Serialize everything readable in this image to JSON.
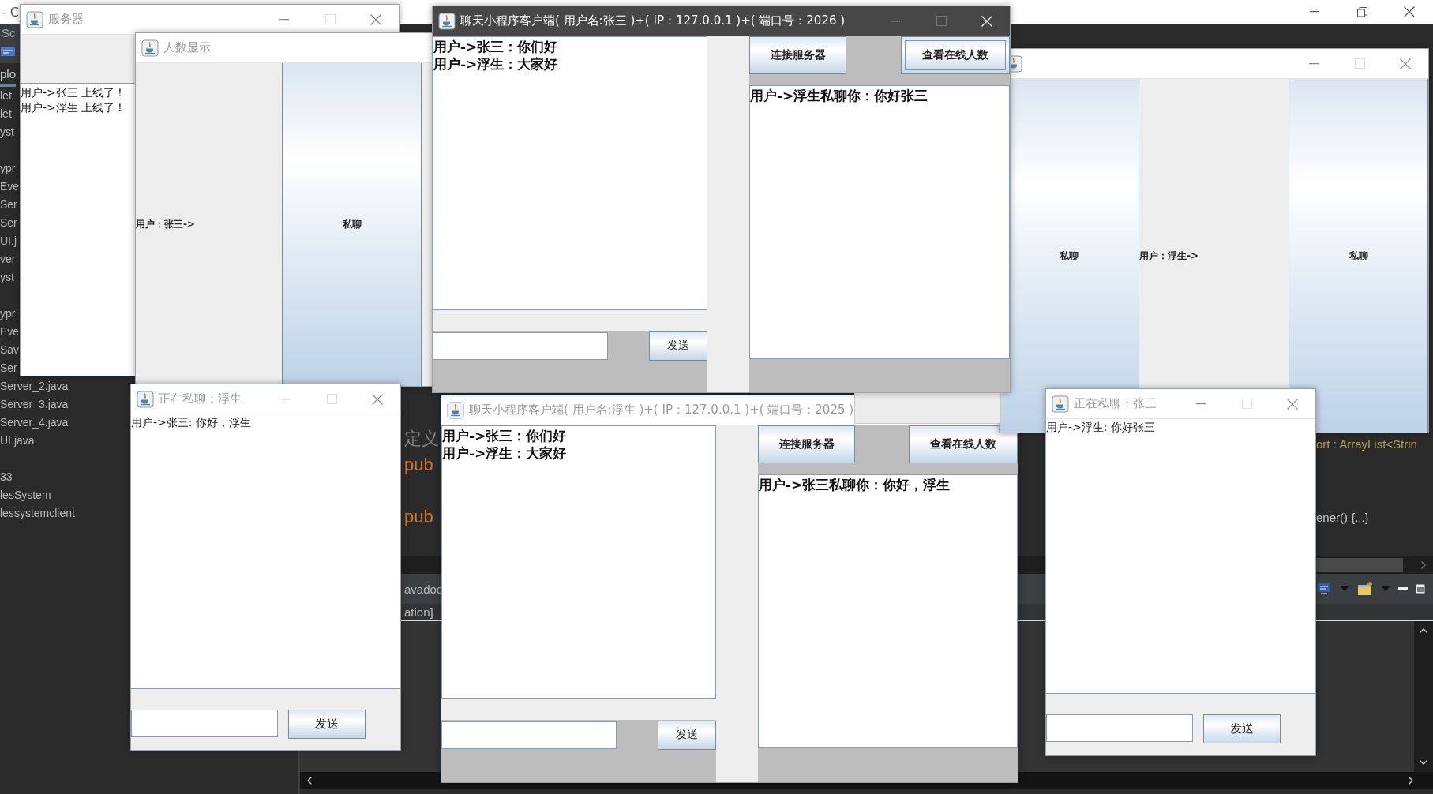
{
  "ide": {
    "title_fragment": "- C",
    "panel_tab": "Sc",
    "explorer_tab": "plo",
    "tree_groups": [
      [
        "let",
        "let",
        "yst"
      ],
      [
        "ypr",
        "Eve",
        "Ser",
        "Ser",
        "UI.j",
        "ver",
        "yst"
      ],
      [
        "ypr",
        "Eve",
        "Sav",
        "Ser",
        "Server_2.java",
        "Server_3.java",
        "Server_4.java",
        "UI.java"
      ],
      [
        "33",
        "lesSystem",
        "lessystemclient"
      ]
    ],
    "code_left": [
      {
        "kind": "comment",
        "text": "定义"
      },
      {
        "kind": "keyword",
        "text": "pub"
      },
      {
        "kind": "keyword",
        "text": "pub"
      }
    ],
    "code_right": [
      {
        "kind": "type",
        "text": "ort : ArrayList<Strin"
      },
      {
        "kind": "plain",
        "text": "ener() {...}"
      }
    ],
    "console_lines": [
      "avadoc",
      "ation]"
    ]
  },
  "server_window": {
    "title": "服务器",
    "active": false,
    "log": [
      "用户->张三 上线了！",
      "用户->浮生 上线了！"
    ]
  },
  "user_list_windows": [
    {
      "title": "人数显示",
      "active": false,
      "cells": [
        {
          "kind": "label",
          "text": "用户：张三->"
        },
        {
          "kind": "button",
          "text": "私聊"
        }
      ]
    },
    {
      "active": false,
      "cells": [
        {
          "kind": "button",
          "text": "私聊"
        },
        {
          "kind": "label",
          "text": "用户：浮生->"
        },
        {
          "kind": "button",
          "text": "私聊"
        }
      ]
    }
  ],
  "client_windows": [
    {
      "title": "聊天小程序客户端( 用户名:张三 )+( IP：127.0.0.1 )+( 端口号：2026 )",
      "active": true,
      "chat": [
        "用户->张三：你们好",
        "用户->浮生：大家好"
      ],
      "buttons": [
        {
          "label": "连接服务器",
          "focused": false
        },
        {
          "label": "查看在线人数",
          "focused": true
        }
      ],
      "private_messages": [
        "用户->浮生私聊你：你好张三"
      ],
      "send_button": "发送"
    },
    {
      "title": "聊天小程序客户端( 用户名:浮生 )+( IP：127.0.0.1 )+( 端口号：2025 )",
      "active": false,
      "chat": [
        "用户->张三：你们好",
        "用户->浮生：大家好"
      ],
      "buttons": [
        {
          "label": "连接服务器",
          "focused": false
        },
        {
          "label": "查看在线人数",
          "focused": false
        }
      ],
      "private_messages": [
        "用户->张三私聊你：你好，浮生"
      ],
      "send_button": "发送"
    }
  ],
  "private_chat_windows": [
    {
      "title": "正在私聊：浮生",
      "active": false,
      "messages": [
        "用户->张三: 你好，浮生"
      ],
      "send_button": "发送"
    },
    {
      "title": "正在私聊：张三",
      "active": false,
      "messages": [
        "用户->浮生: 你好张三"
      ],
      "send_button": "发送"
    }
  ]
}
